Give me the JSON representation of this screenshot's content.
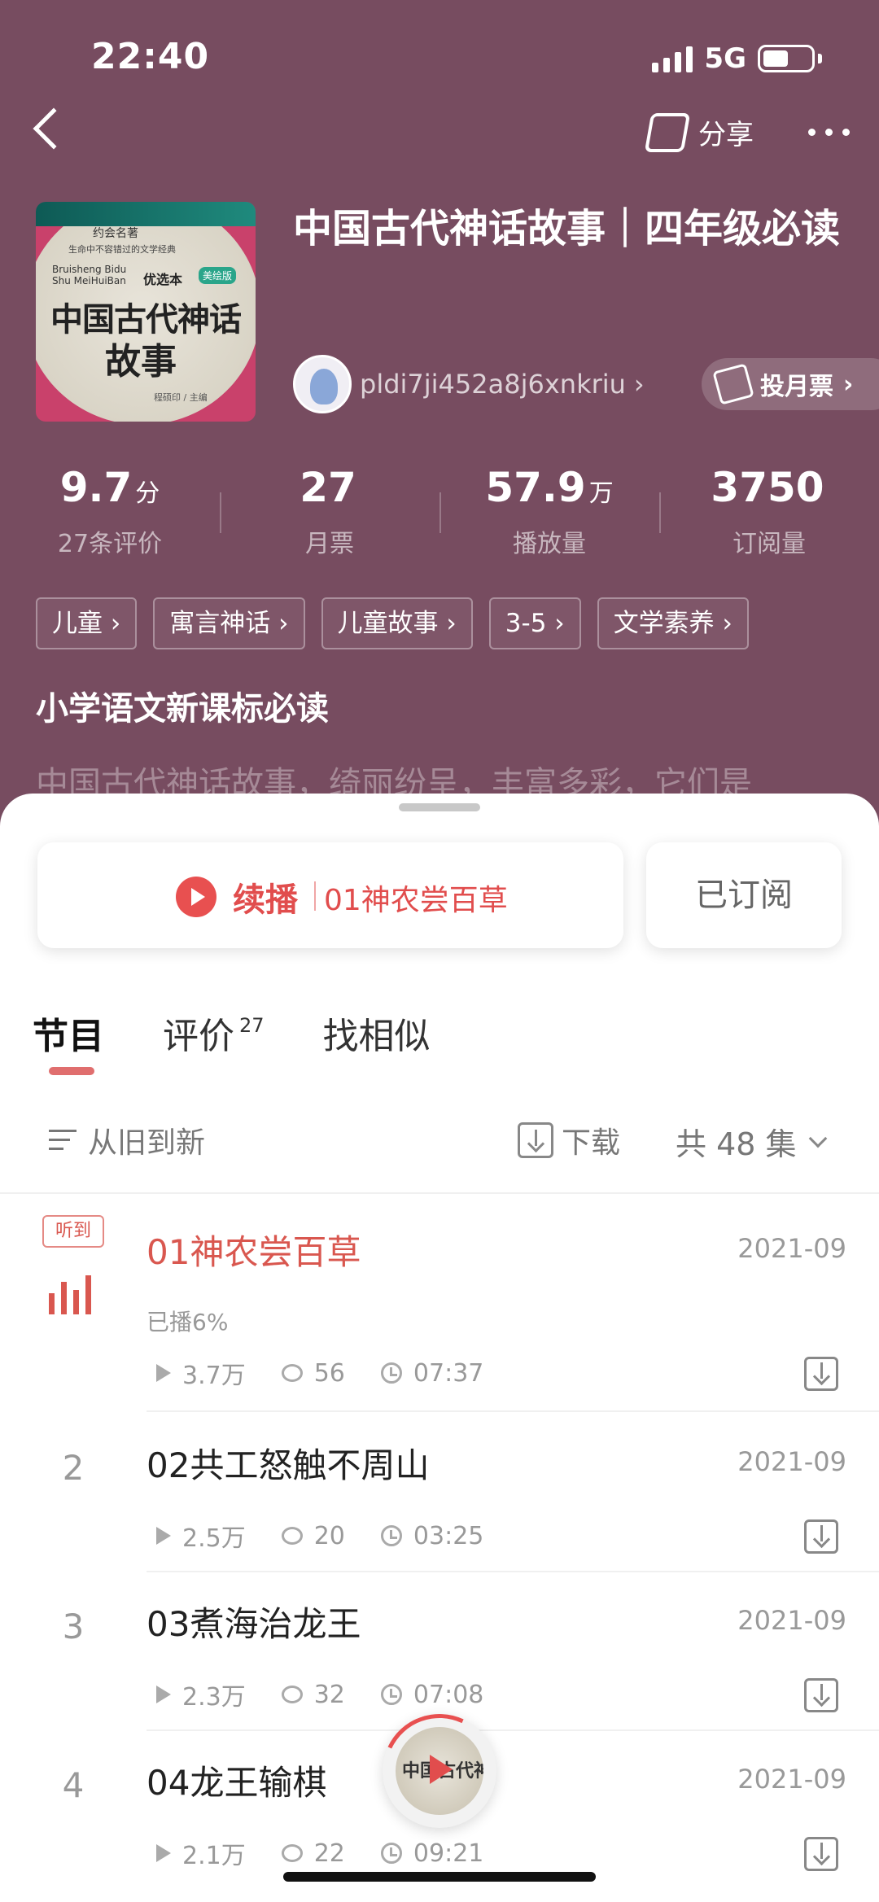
{
  "status_bar": {
    "time": "22:40",
    "network": "5G"
  },
  "header": {
    "share_label": "分享"
  },
  "album": {
    "title": "中国古代神话故事｜四年级必读",
    "author": "pldi7ji452a8j6xnkriu",
    "vote_label": "投月票",
    "cover": {
      "series": "约会名著",
      "subtitle": "生命中不容错过的文学经典",
      "brand": "Bruisheng Bidu Shu MeiHuiBan",
      "badge": "优选本",
      "badge2": "美绘版",
      "title_line1": "中国古代神话",
      "title_line2": "故事",
      "editor": "程硕印 / 主编"
    },
    "stats": [
      {
        "value": "9.7",
        "unit": "分",
        "label": "27条评价"
      },
      {
        "value": "27",
        "unit": "",
        "label": "月票"
      },
      {
        "value": "57.9",
        "unit": "万",
        "label": "播放量"
      },
      {
        "value": "3750",
        "unit": "",
        "label": "订阅量"
      }
    ],
    "tags": [
      "儿童 ›",
      "寓言神话 ›",
      "儿童故事 ›",
      "3-5 ›",
      "文学素养 ›"
    ],
    "subtitle": "小学语文新课标必读",
    "description": "中国古代神话故事，绮丽纷呈，丰富多彩，它们是"
  },
  "actions": {
    "continue_label": "续播",
    "continue_episode": "01神农尝百草",
    "subscribed_label": "已订阅"
  },
  "tabs": [
    {
      "label": "节目",
      "count": ""
    },
    {
      "label": "评价",
      "count": "27"
    },
    {
      "label": "找相似",
      "count": ""
    }
  ],
  "list_bar": {
    "sort_label": "从旧到新",
    "download_label": "下载",
    "count_label": "共 48 集"
  },
  "episodes": [
    {
      "num": "",
      "title": "01神农尝百草",
      "date": "2021-09",
      "plays": "3.7万",
      "comments": "56",
      "duration": "07:37",
      "playing_badge": "听到",
      "played": "已播6%"
    },
    {
      "num": "2",
      "title": "02共工怒触不周山",
      "date": "2021-09",
      "plays": "2.5万",
      "comments": "20",
      "duration": "03:25"
    },
    {
      "num": "3",
      "title": "03煮海治龙王",
      "date": "2021-09",
      "plays": "2.3万",
      "comments": "32",
      "duration": "07:08"
    },
    {
      "num": "4",
      "title": "04龙王输棋",
      "date": "2021-09",
      "plays": "2.1万",
      "comments": "22",
      "duration": "09:21"
    }
  ],
  "mini_player": {
    "cover_text": "中国古代神话"
  },
  "colors": {
    "header_bg": "#774c60",
    "accent": "#d9574f"
  }
}
